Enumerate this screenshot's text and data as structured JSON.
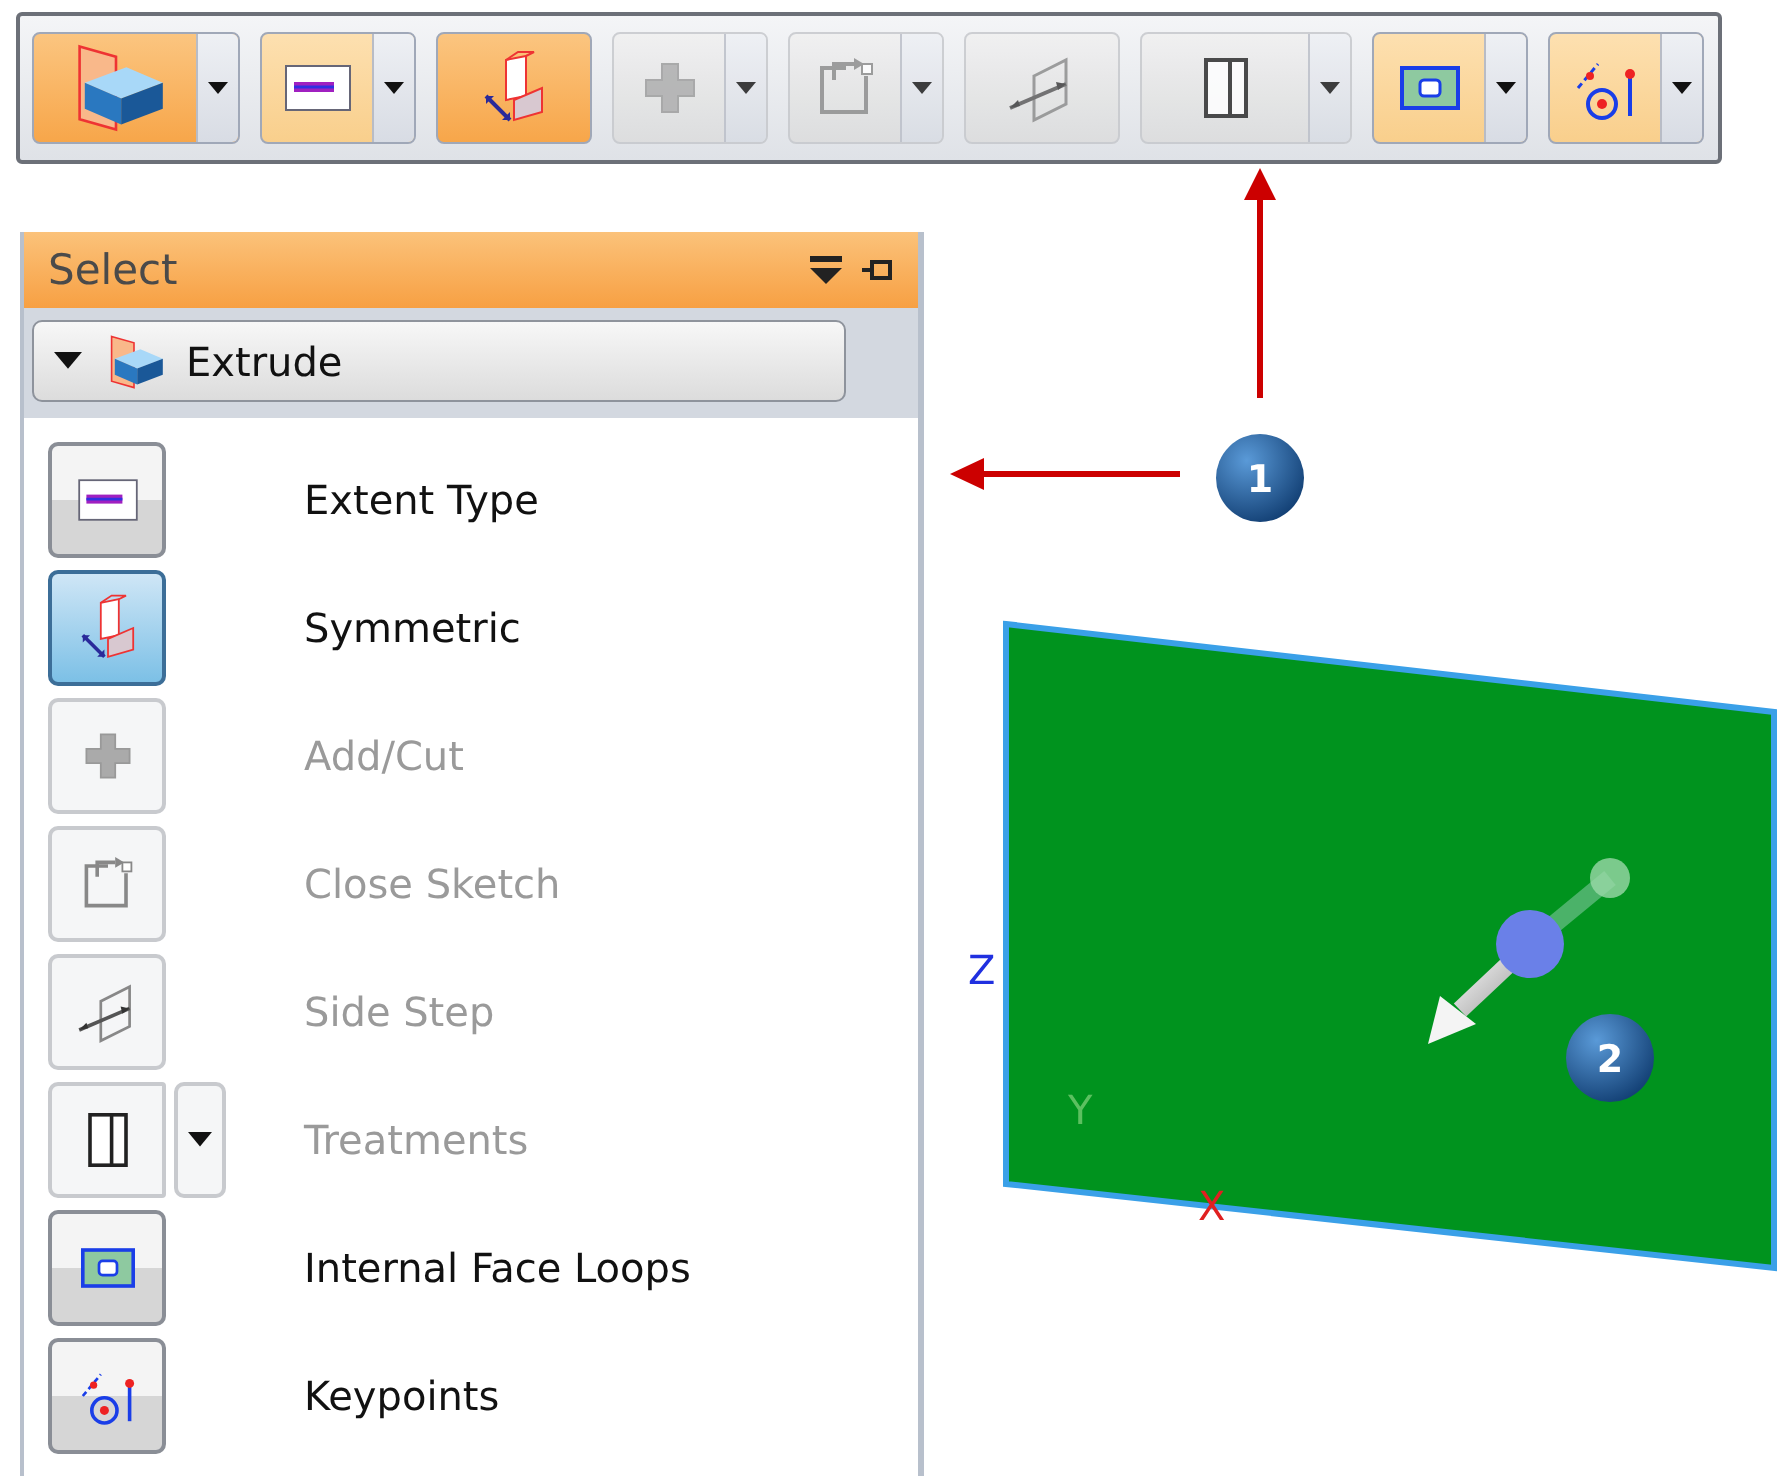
{
  "toolbar": {
    "buttons": [
      {
        "kind": "extrude",
        "enabled": true,
        "highlighted": true,
        "dropdown": true
      },
      {
        "kind": "extent",
        "enabled": true,
        "highlighted": false,
        "dropdown": true
      },
      {
        "kind": "symmetric",
        "enabled": true,
        "highlighted": true,
        "dropdown": false
      },
      {
        "kind": "addcut",
        "enabled": false,
        "highlighted": false,
        "dropdown": true
      },
      {
        "kind": "closesketch",
        "enabled": false,
        "highlighted": false,
        "dropdown": true
      },
      {
        "kind": "sidestep",
        "enabled": false,
        "highlighted": false,
        "dropdown": false
      },
      {
        "kind": "treatments",
        "enabled": false,
        "highlighted": false,
        "dropdown": true
      },
      {
        "kind": "faceloops",
        "enabled": true,
        "highlighted": false,
        "dropdown": true
      },
      {
        "kind": "keypoints",
        "enabled": true,
        "highlighted": false,
        "dropdown": true
      }
    ]
  },
  "panel": {
    "title": "Select",
    "feature": "Extrude",
    "options": [
      {
        "kind": "extent",
        "label": "Extent Type",
        "enabled": true,
        "selected": false,
        "dropdown": false
      },
      {
        "kind": "symmetric",
        "label": "Symmetric",
        "enabled": true,
        "selected": true,
        "dropdown": false
      },
      {
        "kind": "addcut",
        "label": "Add/Cut",
        "enabled": false,
        "selected": false,
        "dropdown": false
      },
      {
        "kind": "closesketch",
        "label": "Close Sketch",
        "enabled": false,
        "selected": false,
        "dropdown": false
      },
      {
        "kind": "sidestep",
        "label": "Side Step",
        "enabled": false,
        "selected": false,
        "dropdown": false
      },
      {
        "kind": "treatments",
        "label": "Treatments",
        "enabled": false,
        "selected": false,
        "dropdown": true
      },
      {
        "kind": "faceloops",
        "label": "Internal Face Loops",
        "enabled": true,
        "selected": false,
        "dropdown": false
      },
      {
        "kind": "keypoints",
        "label": "Keypoints",
        "enabled": true,
        "selected": false,
        "dropdown": false
      }
    ]
  },
  "canvas": {
    "callouts": [
      "1",
      "2"
    ],
    "axes": {
      "z": "Z",
      "y": "Y",
      "x": "X"
    }
  }
}
